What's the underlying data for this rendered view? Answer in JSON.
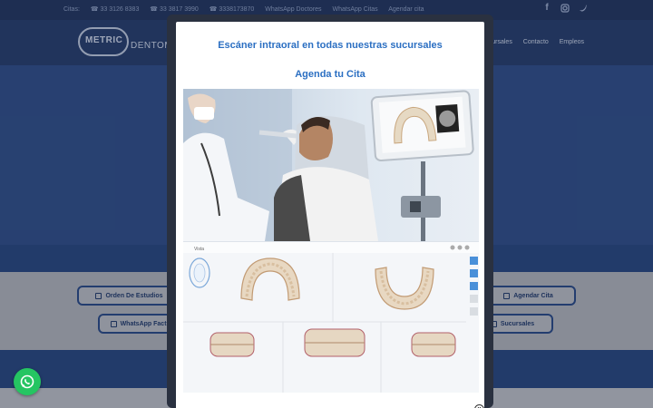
{
  "topbar": {
    "citas_label": "Citas:",
    "phones": [
      "☎ 33 3126 8383",
      "☎ 33 3817 3990",
      "☎ 3338173870"
    ],
    "links": [
      "WhatsApp Doctores",
      "WhatsApp Citas",
      "Agendar cita"
    ]
  },
  "logo": {
    "brand": "METRIC",
    "name": "DENTOME"
  },
  "nav": {
    "items": [
      "Sucursales",
      "Contacto",
      "Empleos"
    ]
  },
  "background_buttons": {
    "orden": "Orden De Estudios",
    "agendar": "Agendar Cita",
    "whatsapp_facturas": "WhatsApp Factura",
    "sucursales": "Sucursales"
  },
  "modal": {
    "title": "Escáner intraoral en todas nuestras sucursales",
    "subtitle": "Agenda tu Cita",
    "close": "x"
  },
  "scan_ui": {
    "header": "Vista"
  },
  "colors": {
    "accent": "#2b6fc2",
    "whatsapp": "#25c562",
    "brand_blue": "#2c4d8a"
  }
}
